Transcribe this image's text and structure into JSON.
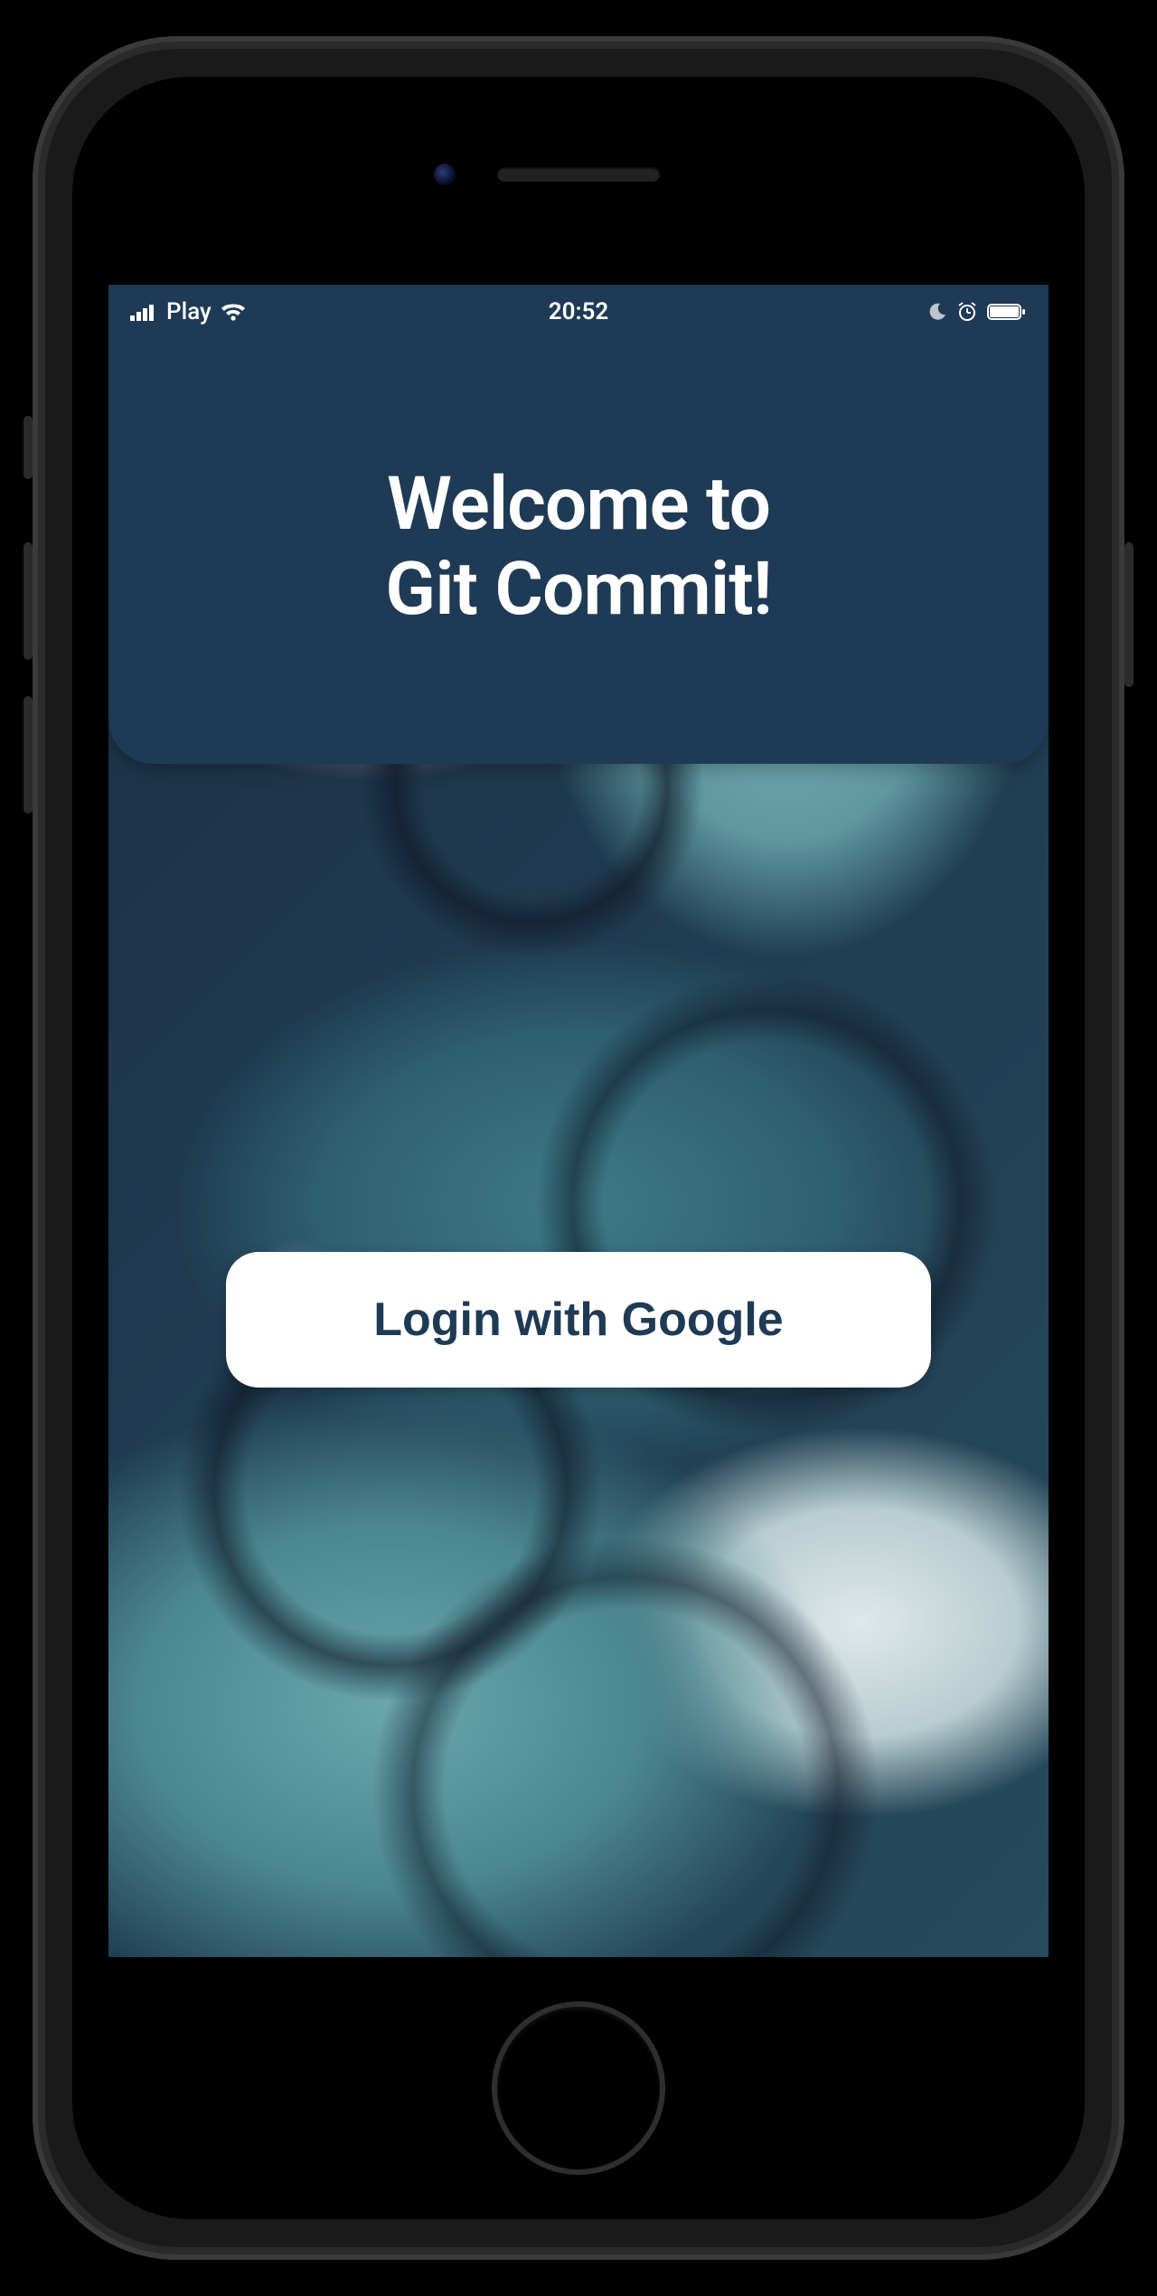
{
  "status_bar": {
    "carrier": "Play",
    "time": "20:52",
    "signal_icon": "signal-icon",
    "wifi_icon": "wifi-icon",
    "moon_icon": "moon-icon",
    "alarm_icon": "alarm-icon",
    "battery_icon": "battery-icon"
  },
  "header": {
    "title": "Welcome to\nGit Commit!"
  },
  "login": {
    "button_label": "Login with Google"
  },
  "colors": {
    "header_bg": "#1f3a55",
    "button_bg": "#ffffff",
    "button_text": "#1f3a55"
  }
}
